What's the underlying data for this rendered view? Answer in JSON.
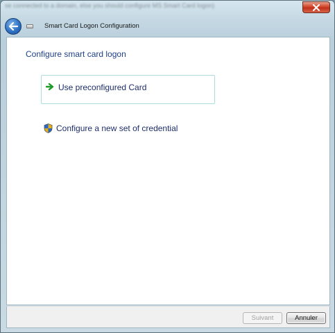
{
  "background_text": "se connected to a domain, else you should configure MS Smart Card logon)",
  "window": {
    "title": "Smart Card Logon Configuration"
  },
  "page": {
    "heading": "Configure smart card logon"
  },
  "options": [
    {
      "label": "Use preconfigured Card",
      "icon": "green-arrow-icon"
    },
    {
      "label": "Configure a new set of credential",
      "icon": "uac-shield-icon"
    }
  ],
  "footer": {
    "next_label": "Suivant",
    "cancel_label": "Annuler",
    "next_enabled": false
  },
  "colors": {
    "heading": "#1e3f8a",
    "option_text": "#1e2e6b",
    "option_border": "#a9dde0",
    "close_red": "#c0311a",
    "back_blue": "#2f72c4"
  }
}
